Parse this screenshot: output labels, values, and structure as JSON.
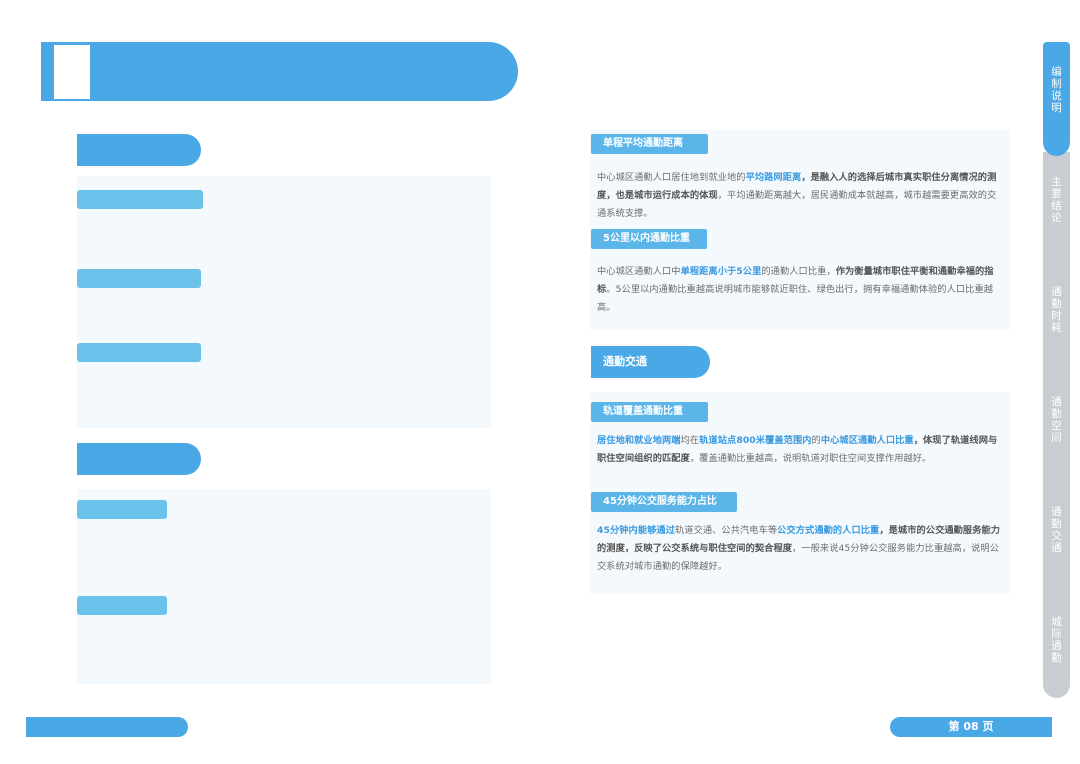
{
  "right": {
    "section1": {
      "tag1": "单程平均通勤距离",
      "p1": {
        "a": "中心城区通勤人口居住地到就业地的",
        "b": "平均路网距离",
        "c": "，是融入人的选择后城市真实职住分离情况的测度，也是城市运行成本的体现",
        "d": "，平均通勤距离越大，居民通勤成本就越高，城市越需要更高效的交通系统支撑。"
      },
      "tag2": "5公里以内通勤比重",
      "p2": {
        "a": "中心城区通勤人口中",
        "b": "单程距离小于5公里",
        "c": "的通勤人口比重，",
        "d": "作为衡量城市职住平衡和通勤幸福的指标",
        "e": "。5公里以内通勤比重越高说明城市能够就近职住、绿色出行，拥有幸福通勤体验的人口比重越高。"
      }
    },
    "section_title": "通勤交通",
    "section2": {
      "tag1": "轨道覆盖通勤比重",
      "p1": {
        "a": "居住地和就业地两端",
        "b": "均在",
        "c": "轨道站点800米覆盖范围内",
        "d": "的",
        "e": "中心城区通勤人口比重",
        "f": "，体现了轨道线网与职住空间组织的匹配度",
        "g": "，覆盖通勤比重越高，说明轨道对职住空间支撑作用越好。"
      },
      "tag2": "45分钟公交服务能力占比",
      "p2": {
        "a": "45分钟内能够通过",
        "b": "轨道交通、公共汽电车等",
        "c": "公交方式通勤的人口比重",
        "d": "，是城市的公交通勤服务能力的测度，反映了公交系统与职住空间的契合程度",
        "e": "，一般来说45分钟公交服务能力比重越高，说明公交系统对城市通勤的保障越好。"
      }
    }
  },
  "sidenav": [
    {
      "label": "编制说明",
      "active": true
    },
    {
      "label": "主要结论",
      "active": false
    },
    {
      "label": "通勤时耗",
      "active": false
    },
    {
      "label": "通勤空间",
      "active": false
    },
    {
      "label": "通勤交通",
      "active": false
    },
    {
      "label": "城际通勤",
      "active": false
    }
  ],
  "footer": {
    "page_label": "第 08 页"
  },
  "colors": {
    "accent": "#4aa8e6",
    "light_accent": "#6ac1ea",
    "nav_inactive": "#c7cdd3",
    "panel_bg": "#f4f9fd"
  }
}
